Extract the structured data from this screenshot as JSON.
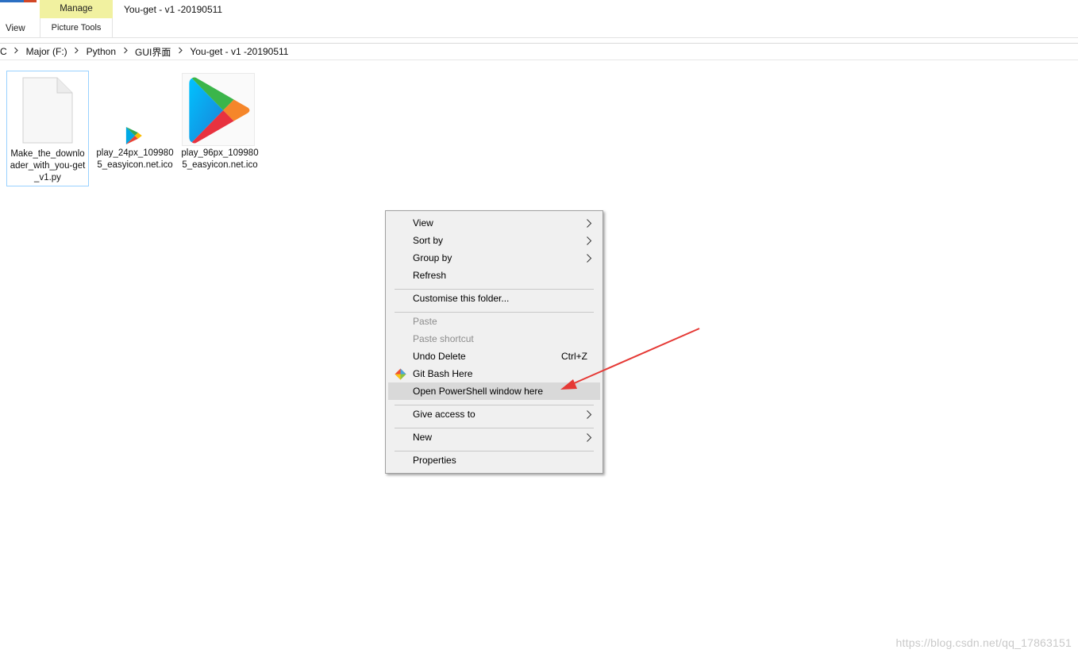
{
  "ribbon": {
    "view_tab": "View",
    "manage_tab": "Manage",
    "picture_tools": "Picture Tools",
    "window_title": "You-get - v1 -20190511"
  },
  "address_bar": {
    "crumbs": [
      "C",
      "Major (F:)",
      "Python",
      "GUI界面",
      "You-get - v1 -20190511"
    ]
  },
  "files": [
    {
      "name": "Make_the_downloader_with_you-get_v1.py",
      "icon": "document-icon",
      "selected": true
    },
    {
      "name": "play_24px_1099805_easyicon.net.ico",
      "icon": "play-store-icon-small",
      "selected": false
    },
    {
      "name": "play_96px_1099805_easyicon.net.ico",
      "icon": "play-store-icon-large",
      "selected": false
    }
  ],
  "context_menu": {
    "items": [
      {
        "label": "View",
        "submenu": true
      },
      {
        "label": "Sort by",
        "submenu": true
      },
      {
        "label": "Group by",
        "submenu": true
      },
      {
        "label": "Refresh"
      },
      {
        "label": "Customise this folder..."
      },
      {
        "label": "Paste",
        "disabled": true
      },
      {
        "label": "Paste shortcut",
        "disabled": true
      },
      {
        "label": "Undo Delete",
        "shortcut": "Ctrl+Z"
      },
      {
        "label": "Git Bash Here",
        "icon": "git-icon"
      },
      {
        "label": "Open PowerShell window here",
        "highlighted": true
      },
      {
        "label": "Give access to",
        "submenu": true
      },
      {
        "label": "New",
        "submenu": true
      },
      {
        "label": "Properties"
      }
    ]
  },
  "annotation": {
    "color": "#e53935",
    "type": "arrow"
  },
  "watermark": "https://blog.csdn.net/qq_17863151",
  "colors": {
    "manage_tab_bg": "#f1f1a0",
    "selection_border": "#99d1ff",
    "menu_bg": "#f0f0f0",
    "menu_highlight": "#d9d9d9"
  }
}
